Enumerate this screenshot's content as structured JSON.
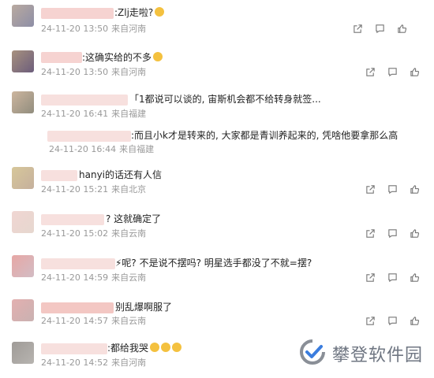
{
  "comments": [
    {
      "text": ":Zlj走啦?",
      "emoji_count": 1,
      "date": "24-11-20 13:50",
      "location": "来自河南",
      "show_actions": true
    },
    {
      "text": ":这确实给的不多",
      "emoji_count": 1,
      "date": "24-11-20 13:50",
      "location": "来自河南",
      "show_actions": true
    },
    {
      "text": "「1都说可以谈的, 宙斯机会都不给转身就签...",
      "emoji_count": 0,
      "date": "24-11-20 16:41",
      "location": "来自福建",
      "show_actions": true
    },
    {
      "text": ":而且小k才是转来的, 大家都是青训养起来的, 凭啥他要拿那么高",
      "emoji_count": 0,
      "date": "24-11-20 16:44",
      "location": "来自福建",
      "show_actions": false
    },
    {
      "text": "hanyi的话还有人信",
      "emoji_count": 0,
      "date": "24-11-20 15:21",
      "location": "来自北京",
      "show_actions": true
    },
    {
      "text": "? 这就确定了",
      "emoji_count": 0,
      "date": "24-11-20 15:02",
      "location": "来自云南",
      "show_actions": true
    },
    {
      "text": "⚡呢? 不是说不摆吗? 明星选手都没了不就=摆?",
      "emoji_count": 0,
      "date": "24-11-20 14:59",
      "location": "来自云南",
      "show_actions": true
    },
    {
      "text": "别乱爆啊服了",
      "emoji_count": 0,
      "date": "24-11-20 14:57",
      "location": "来自云南",
      "show_actions": true
    },
    {
      "text": ":都给我哭",
      "emoji_count": 3,
      "date": "24-11-20 14:52",
      "location": "来自河南",
      "show_actions": false
    }
  ],
  "watermark": {
    "text": "攀登软件园",
    "icon": "brand-check-icon"
  },
  "icons": [
    "share-icon",
    "comment-icon",
    "like-icon"
  ],
  "colors": {
    "text": "#222222",
    "meta": "#999999",
    "watermark": "#6f7682"
  }
}
